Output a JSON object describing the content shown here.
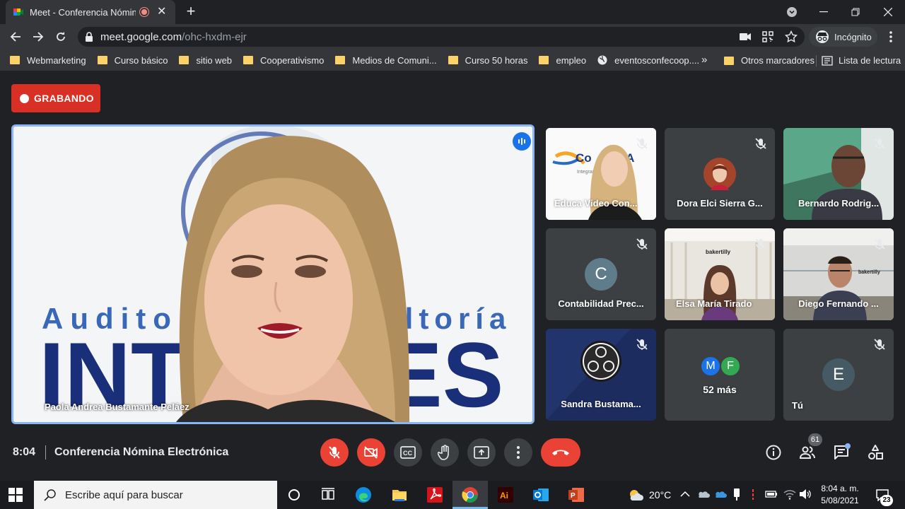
{
  "browser": {
    "tab_title": "Meet - Conferencia Nómina",
    "url_host": "meet.google.com",
    "url_path": "/ohc-hxdm-ejr",
    "profile_label": "Incógnito"
  },
  "bookmarks": [
    {
      "label": "Webmarketing",
      "icon": "folder-icon"
    },
    {
      "label": "Curso básico",
      "icon": "folder-icon"
    },
    {
      "label": "sitio web",
      "icon": "folder-icon"
    },
    {
      "label": "Cooperativismo",
      "icon": "folder-icon"
    },
    {
      "label": "Medios de Comuni...",
      "icon": "folder-icon"
    },
    {
      "label": "Curso 50 horas",
      "icon": "folder-icon"
    },
    {
      "label": "empleo",
      "icon": "folder-icon"
    },
    {
      "label": "eventosconfecoop....",
      "icon": "globe-icon"
    }
  ],
  "bookmarks_right": {
    "overflow": "»",
    "other": "Otros marcadores",
    "reading_list": "Lista de lectura"
  },
  "meet": {
    "recording_label": "GRABANDO",
    "main_speaker": "Paola Andrea Bustamante Peláez",
    "main_background_text": {
      "line1_left": "Audito",
      "line1_right": "ultoría",
      "line2_left": "INT",
      "line2_right": "ES"
    },
    "participants": [
      {
        "name": "Educa Video Con...",
        "muted": true,
        "logo_text": "Co     op A       a",
        "logo_sub": "Integrando pa"
      },
      {
        "name": "Dora Elci Sierra G...",
        "muted": true
      },
      {
        "name": "Bernardo Rodrig...",
        "muted": true
      },
      {
        "name": "Contabilidad Prec...",
        "muted": true,
        "initial": "C"
      },
      {
        "name": "Elsa María Tirado",
        "muted": true,
        "logo_text": "bakertilly"
      },
      {
        "name": "Diego Fernando ...",
        "muted": true,
        "logo_text": "bakertilly"
      },
      {
        "name": "Sandra Bustama...",
        "muted": true
      },
      {
        "name": "52 más",
        "avatars": [
          "M",
          "F"
        ]
      },
      {
        "name": "Tú",
        "muted": true,
        "initial": "E"
      }
    ],
    "time": "8:04",
    "meeting_title": "Conferencia Nómina Electrónica",
    "people_count": "61",
    "colors": {
      "accent": "#8ab4f8",
      "danger": "#ea4335",
      "recording": "#d93025"
    }
  },
  "taskbar": {
    "search_placeholder": "Escribe aquí para buscar",
    "weather": "20°C",
    "time": "8:04 a. m.",
    "date": "5/08/2021",
    "notifications": "23"
  }
}
